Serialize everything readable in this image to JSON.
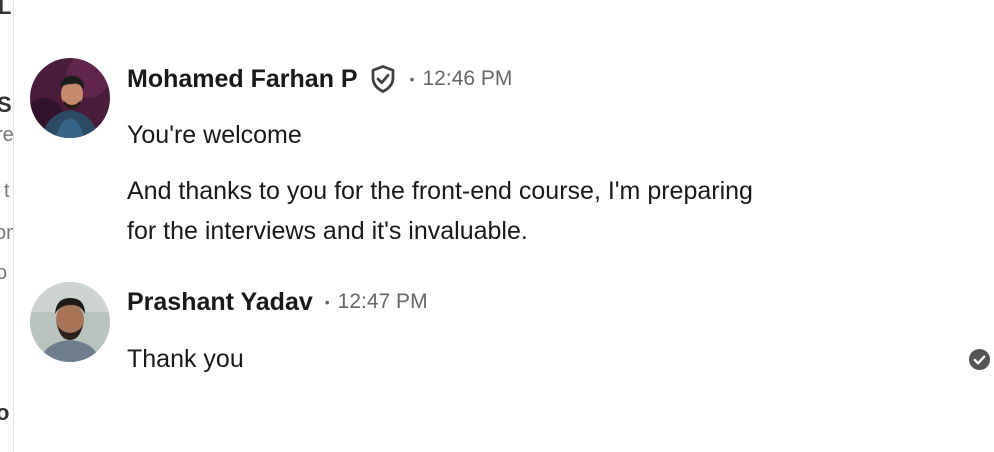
{
  "messages": [
    {
      "sender": "Mohamed Farhan P",
      "verified": true,
      "time": "12:46 PM",
      "paragraphs": [
        "You're welcome",
        "And thanks to you for the front-end course, I'm preparing",
        "for the interviews and it's invaluable."
      ]
    },
    {
      "sender": "Prashant Yadav",
      "verified": false,
      "time": "12:47 PM",
      "paragraphs": [
        "Thank you"
      ],
      "status_icon": "read-receipt-check-icon"
    }
  ],
  "separator": "•",
  "left_panel_fragments": [
    "L",
    "Si",
    "re",
    "j t",
    "on",
    "o",
    "o"
  ],
  "colors": {
    "avatar1_bg": "#4a1b3a",
    "avatar2_bg": "#b9c3bd",
    "read_icon": "#555555",
    "timestamp": "#666666"
  }
}
